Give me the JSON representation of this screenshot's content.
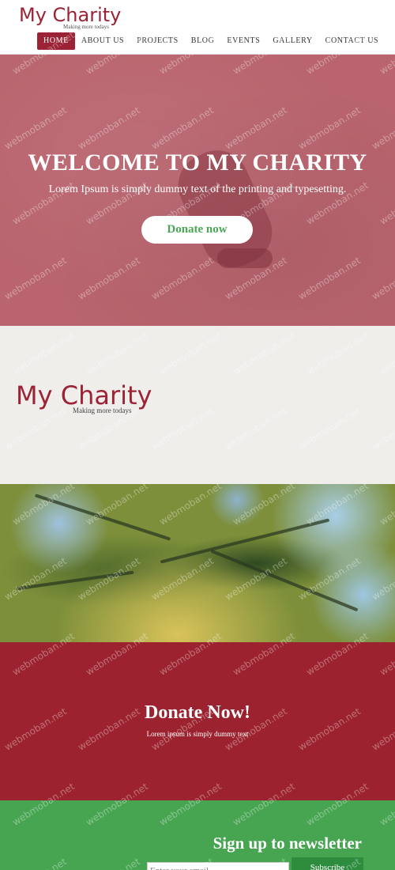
{
  "header": {
    "logo_title": "My Charity",
    "logo_tagline": "Making more todays",
    "nav": [
      {
        "label": "HOME"
      },
      {
        "label": "ABOUT US"
      },
      {
        "label": "PROJECTS"
      },
      {
        "label": "BLOG"
      },
      {
        "label": "EVENTS"
      },
      {
        "label": "GALLERY"
      },
      {
        "label": "CONTACT US"
      }
    ]
  },
  "hero": {
    "title": "WELCOME TO MY CHARITY",
    "subtitle": "Lorem Ipsum is simply dummy text of the printing and typesetting.",
    "button_label": "Donate now"
  },
  "logo_band": {
    "logo_title": "My Charity",
    "logo_tagline": "Making more todays"
  },
  "donate": {
    "title": "Donate Now!",
    "subtitle": "Lorem ipsum is simply dummy text"
  },
  "newsletter": {
    "title": "Sign up to newsletter",
    "email_placeholder": "Enter your email",
    "button_label": "Subscribe"
  },
  "watermark": "webmoban.net",
  "colors": {
    "brand_red": "#9b2335",
    "hero_pink": "#b9646e",
    "donate_red": "#9b222e",
    "newsletter_green": "#47a552",
    "button_green_text": "#4aa655",
    "logo_band_bg": "#efeeeb"
  }
}
